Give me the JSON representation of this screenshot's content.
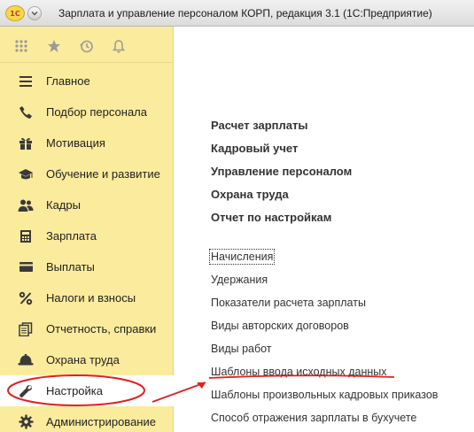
{
  "window": {
    "logo_text": "1С",
    "title": "Зарплата и управление персоналом КОРП, редакция 3.1  (1С:Предприятие)"
  },
  "toolbar": {
    "icons": [
      "apps-grid-icon",
      "favorites-star-icon",
      "history-icon",
      "notifications-bell-icon"
    ]
  },
  "sidebar": {
    "items": [
      {
        "label": "Главное",
        "icon": "menu-lines-icon"
      },
      {
        "label": "Подбор персонала",
        "icon": "phone-icon"
      },
      {
        "label": "Мотивация",
        "icon": "gift-icon"
      },
      {
        "label": "Обучение и развитие",
        "icon": "graduation-cap-icon"
      },
      {
        "label": "Кадры",
        "icon": "people-icon"
      },
      {
        "label": "Зарплата",
        "icon": "calculator-icon"
      },
      {
        "label": "Выплаты",
        "icon": "card-icon"
      },
      {
        "label": "Налоги и взносы",
        "icon": "percent-icon"
      },
      {
        "label": "Отчетность, справки",
        "icon": "documents-icon"
      },
      {
        "label": "Охрана труда",
        "icon": "helmet-icon"
      },
      {
        "label": "Настройка",
        "icon": "wrench-icon"
      },
      {
        "label": "Администрирование",
        "icon": "gear-icon"
      }
    ],
    "active_index": 10
  },
  "content": {
    "sections": [
      "Расчет зарплаты",
      "Кадровый учет",
      "Управление персоналом",
      "Охрана труда",
      "Отчет по настройкам"
    ],
    "commands": [
      "Начисления",
      "Удержания",
      "Показатели расчета зарплаты",
      "Виды авторских договоров",
      "Виды работ",
      "Шаблоны ввода исходных данных",
      "Шаблоны произвольных кадровых приказов",
      "Способ отражения зарплаты в бухучете"
    ]
  },
  "colors": {
    "sidebar_bg": "#fbeb9c",
    "annotation_red": "#e02020"
  }
}
